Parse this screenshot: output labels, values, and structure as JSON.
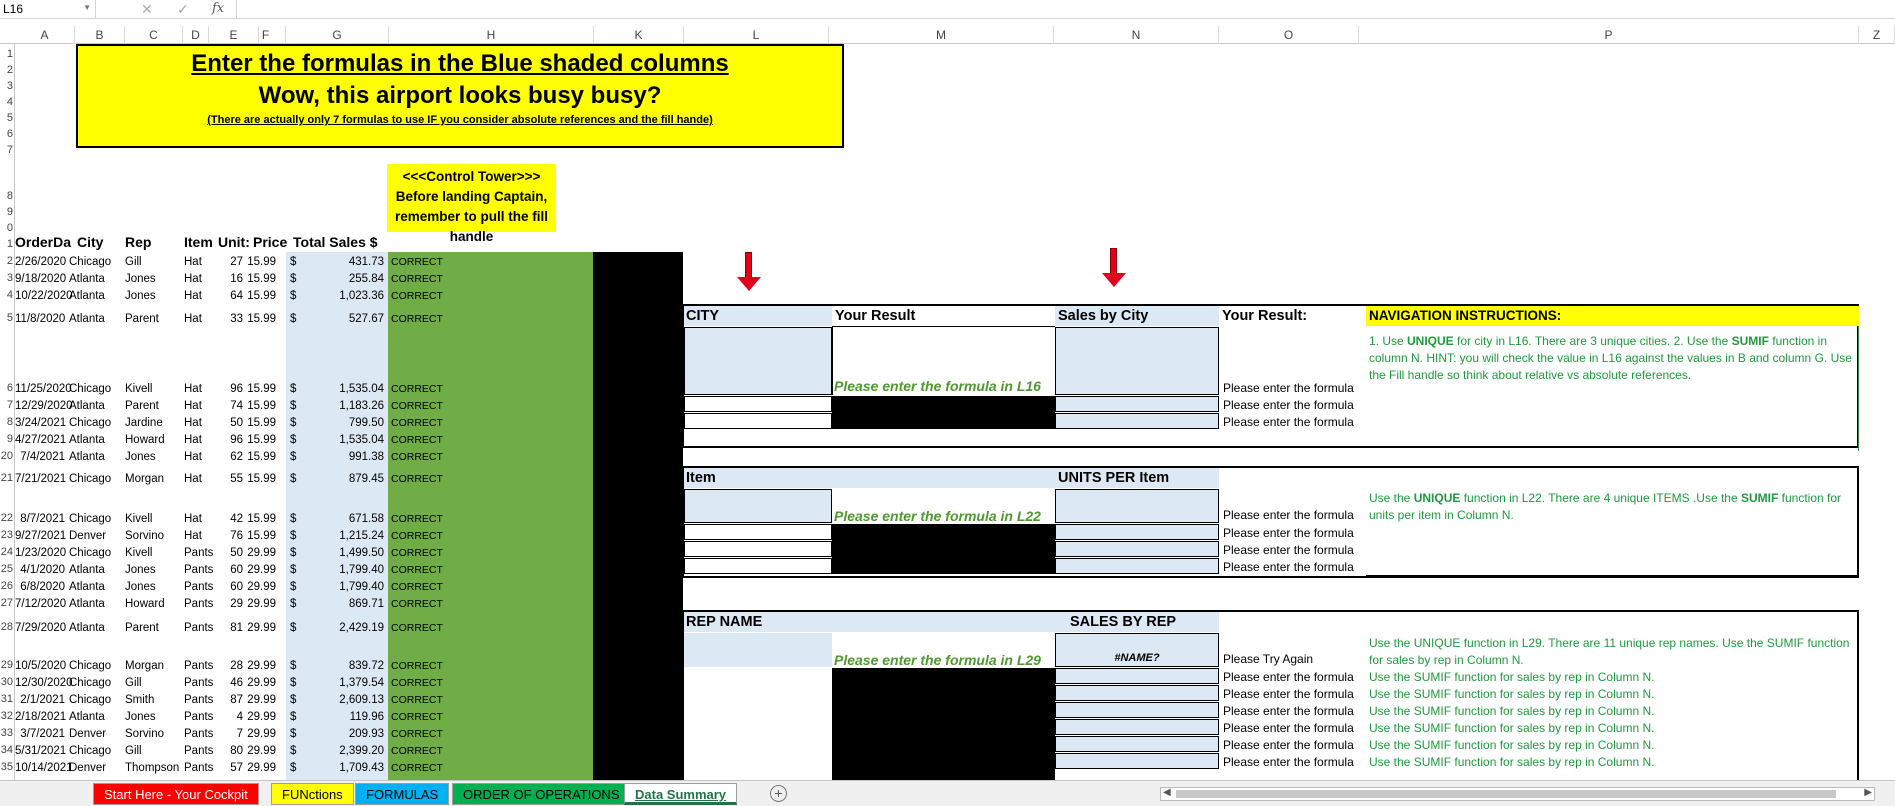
{
  "formula_bar": {
    "name_box": "L16",
    "cancel_icon": "✕",
    "enter_icon": "✓",
    "fx": "fx",
    "formula": ""
  },
  "columns": [
    "A",
    "B",
    "C",
    "D",
    "E",
    "F",
    "G",
    "H",
    "K",
    "L",
    "M",
    "N",
    "O",
    "P",
    "Z"
  ],
  "rows": [
    "1",
    "2",
    "3",
    "4",
    "5",
    "6",
    "7",
    "8",
    "9",
    "0",
    "1",
    "2",
    "3",
    "4",
    "5",
    "6",
    "7",
    "8",
    "9",
    "20",
    "21",
    "22",
    "23",
    "24",
    "25",
    "26",
    "27",
    "28",
    "29",
    "30",
    "31",
    "32",
    "33",
    "34",
    "35"
  ],
  "banner": {
    "title": "Enter the formulas in the Blue shaded columns",
    "subtitle": "Wow, this airport looks busy busy?",
    "note": "(There are actually only 7 formulas to use IF you consider absolute references and the fill hande)"
  },
  "tower": "<<<Control Tower>>> Before landing Captain, remember to pull the fill handle",
  "headers": {
    "date": "OrderDa",
    "city": "City",
    "rep": "Rep",
    "item": "Item",
    "units": "Unit:",
    "price": "Price",
    "total": "Total Sales $"
  },
  "sales": [
    {
      "date": "2/26/2020",
      "city": "Chicago",
      "rep": "Gill",
      "item": "Hat",
      "units": "27",
      "price": "15.99",
      "total": "431.73",
      "status": "CORRECT"
    },
    {
      "date": "9/18/2020",
      "city": "Atlanta",
      "rep": "Jones",
      "item": "Hat",
      "units": "16",
      "price": "15.99",
      "total": "255.84",
      "status": "CORRECT"
    },
    {
      "date": "10/22/2020",
      "city": "Atlanta",
      "rep": "Jones",
      "item": "Hat",
      "units": "64",
      "price": "15.99",
      "total": "1,023.36",
      "status": "CORRECT"
    },
    {
      "date": "11/8/2020",
      "city": "Atlanta",
      "rep": "Parent",
      "item": "Hat",
      "units": "33",
      "price": "15.99",
      "total": "527.67",
      "status": "CORRECT"
    },
    {
      "date": "11/25/2020",
      "city": "Chicago",
      "rep": "Kivell",
      "item": "Hat",
      "units": "96",
      "price": "15.99",
      "total": "1,535.04",
      "status": "CORRECT"
    },
    {
      "date": "12/29/2020",
      "city": "Atlanta",
      "rep": "Parent",
      "item": "Hat",
      "units": "74",
      "price": "15.99",
      "total": "1,183.26",
      "status": "CORRECT"
    },
    {
      "date": "3/24/2021",
      "city": "Chicago",
      "rep": "Jardine",
      "item": "Hat",
      "units": "50",
      "price": "15.99",
      "total": "799.50",
      "status": "CORRECT"
    },
    {
      "date": "4/27/2021",
      "city": "Atlanta",
      "rep": "Howard",
      "item": "Hat",
      "units": "96",
      "price": "15.99",
      "total": "1,535.04",
      "status": "CORRECT"
    },
    {
      "date": "7/4/2021",
      "city": "Atlanta",
      "rep": "Jones",
      "item": "Hat",
      "units": "62",
      "price": "15.99",
      "total": "991.38",
      "status": "CORRECT"
    },
    {
      "date": "7/21/2021",
      "city": "Chicago",
      "rep": "Morgan",
      "item": "Hat",
      "units": "55",
      "price": "15.99",
      "total": "879.45",
      "status": "CORRECT"
    },
    {
      "date": "8/7/2021",
      "city": "Chicago",
      "rep": "Kivell",
      "item": "Hat",
      "units": "42",
      "price": "15.99",
      "total": "671.58",
      "status": "CORRECT"
    },
    {
      "date": "9/27/2021",
      "city": "Denver",
      "rep": "Sorvino",
      "item": "Hat",
      "units": "76",
      "price": "15.99",
      "total": "1,215.24",
      "status": "CORRECT"
    },
    {
      "date": "1/23/2020",
      "city": "Chicago",
      "rep": "Kivell",
      "item": "Pants",
      "units": "50",
      "price": "29.99",
      "total": "1,499.50",
      "status": "CORRECT"
    },
    {
      "date": "4/1/2020",
      "city": "Atlanta",
      "rep": "Jones",
      "item": "Pants",
      "units": "60",
      "price": "29.99",
      "total": "1,799.40",
      "status": "CORRECT"
    },
    {
      "date": "6/8/2020",
      "city": "Atlanta",
      "rep": "Jones",
      "item": "Pants",
      "units": "60",
      "price": "29.99",
      "total": "1,799.40",
      "status": "CORRECT"
    },
    {
      "date": "7/12/2020",
      "city": "Atlanta",
      "rep": "Howard",
      "item": "Pants",
      "units": "29",
      "price": "29.99",
      "total": "869.71",
      "status": "CORRECT"
    },
    {
      "date": "7/29/2020",
      "city": "Atlanta",
      "rep": "Parent",
      "item": "Pants",
      "units": "81",
      "price": "29.99",
      "total": "2,429.19",
      "status": "CORRECT"
    },
    {
      "date": "10/5/2020",
      "city": "Chicago",
      "rep": "Morgan",
      "item": "Pants",
      "units": "28",
      "price": "29.99",
      "total": "839.72",
      "status": "CORRECT"
    },
    {
      "date": "12/30/2020",
      "city": "Chicago",
      "rep": "Gill",
      "item": "Pants",
      "units": "46",
      "price": "29.99",
      "total": "1,379.54",
      "status": "CORRECT"
    },
    {
      "date": "2/1/2021",
      "city": "Chicago",
      "rep": "Smith",
      "item": "Pants",
      "units": "87",
      "price": "29.99",
      "total": "2,609.13",
      "status": "CORRECT"
    },
    {
      "date": "2/18/2021",
      "city": "Atlanta",
      "rep": "Jones",
      "item": "Pants",
      "units": "4",
      "price": "29.99",
      "total": "119.96",
      "status": "CORRECT"
    },
    {
      "date": "3/7/2021",
      "city": "Denver",
      "rep": "Sorvino",
      "item": "Pants",
      "units": "7",
      "price": "29.99",
      "total": "209.93",
      "status": "CORRECT"
    },
    {
      "date": "5/31/2021",
      "city": "Chicago",
      "rep": "Gill",
      "item": "Pants",
      "units": "80",
      "price": "29.99",
      "total": "2,399.20",
      "status": "CORRECT"
    },
    {
      "date": "10/14/2021",
      "city": "Denver",
      "rep": "Thompson",
      "item": "Pants",
      "units": "57",
      "price": "29.99",
      "total": "1,709.43",
      "status": "CORRECT"
    }
  ],
  "currency": "$",
  "city_table": {
    "city_label": "CITY",
    "result_label": "Your Result",
    "sales_label": "Sales by City",
    "result2_label": "Your Result:",
    "nav_label": "NAVIGATION INSTRUCTIONS:",
    "enter_msg": "Please enter the formula in L16",
    "prompts": [
      "Please enter the formula",
      "Please enter the formula",
      "Please enter the formula"
    ],
    "hint_pre1": "1. Use ",
    "hint_unique": "UNIQUE",
    "hint_mid1": " for city in L16. There are 3 unique cities. 2. Use the ",
    "hint_sumif": "SUMIF",
    "hint_post1": " function in column N. HINT: you will check the value in L16 against the values in B and column G. Use the Fill handle so think about relative vs absolute references."
  },
  "item_table": {
    "item_label": "Item",
    "units_label": "UNITS PER Item",
    "enter_msg": "Please enter the formula in L22",
    "prompts": [
      "Please enter the formula",
      "Please enter the formula",
      "Please enter the formula",
      "Please enter the formula"
    ],
    "hint_pre": "Use the ",
    "hint_unique": "UNIQUE",
    "hint_mid": " function in  L22. There are 4 unique ITEMS .Use the ",
    "hint_sumif": "SUMIF",
    "hint_post": " function for units per item in Column N."
  },
  "rep_table": {
    "rep_label": "REP NAME",
    "sales_label": "SALES BY REP",
    "enter_msg": "Please enter the formula in L29",
    "error": "#NAME?",
    "first_prompt": "Please Try Again",
    "first_hint": "Use the UNIQUE function in L29. There are 11 unique rep names. Use the SUMIF function for sales by rep in Column N.",
    "prompts": [
      "Please enter the formula",
      "Please enter the formula",
      "Please enter the formula",
      "Please enter the formula",
      "Please enter the formula",
      "Please enter the formula"
    ],
    "hints": [
      "Use the SUMIF function for sales by rep in Column N.",
      "Use the SUMIF function for sales by rep in Column N.",
      "Use the SUMIF function for sales by rep in Column N.",
      "Use the SUMIF function for sales by rep in Column N.",
      "Use the SUMIF function for sales by rep in Column N.",
      "Use the SUMIF function for sales by rep in Column N."
    ]
  },
  "tabs": [
    {
      "label": "Start Here - Your Cockpit",
      "bg": "#ff0000",
      "fg": "#ffffff"
    },
    {
      "label": "FUNctions",
      "bg": "#ffff00",
      "fg": "#000000"
    },
    {
      "label": "FORMULAS",
      "bg": "#00b0f0",
      "fg": "#000000"
    },
    {
      "label": "ORDER OF OPERATIONS",
      "bg": "#00b050",
      "fg": "#000000"
    },
    {
      "label": "Data Summary",
      "bg": "#ffffff",
      "fg": "#217346"
    }
  ],
  "add_sheet": "+",
  "colors": {
    "banner": "#ffff00",
    "light_blue": "#dce9f5",
    "green": "#70ad47",
    "hint_green": "#1e9b3c",
    "arrow": "#e3001b"
  }
}
